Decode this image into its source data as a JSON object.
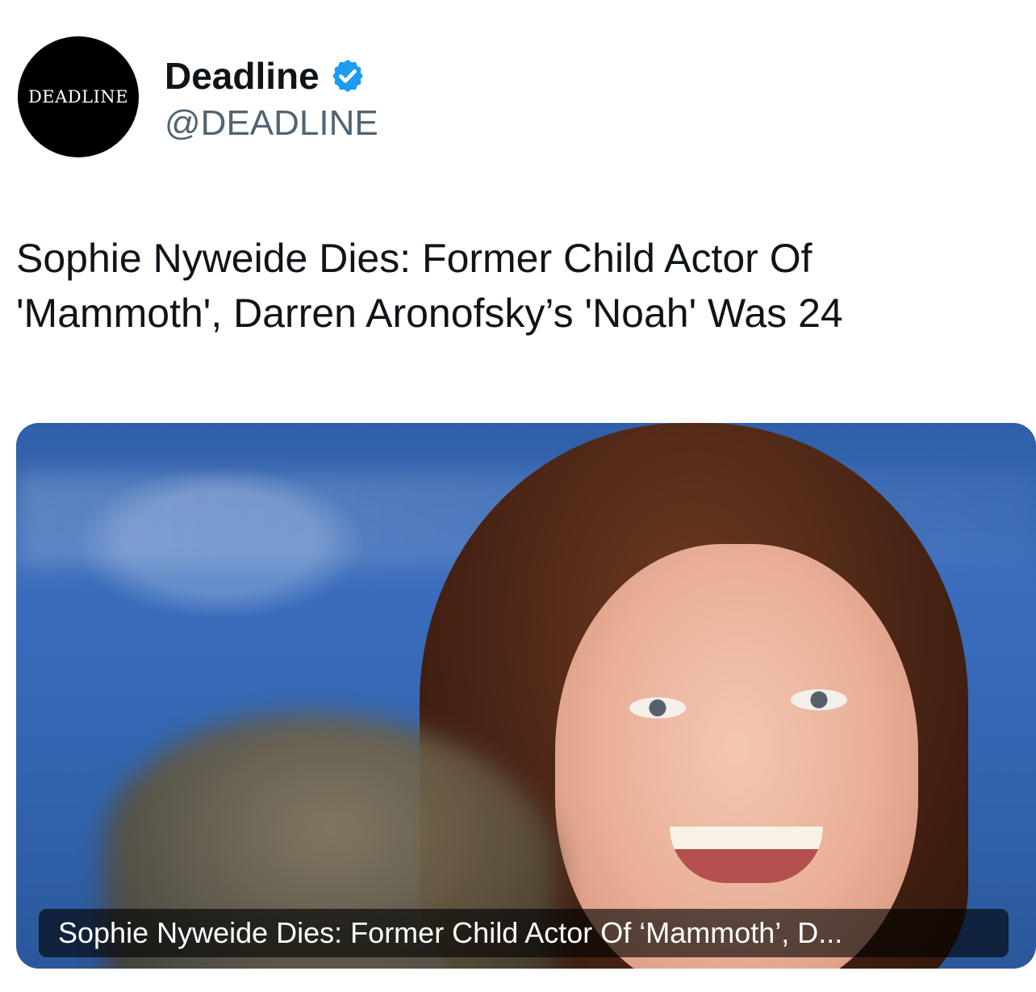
{
  "account": {
    "avatar_text": "DEADLINE",
    "display_name": "Deadline",
    "handle": "@DEADLINE",
    "verified_icon": "verified-badge-icon",
    "verified_color": "#1d9bf0"
  },
  "tweet": {
    "text_line1": "Sophie Nyweide Dies: Former Child Actor Of",
    "text_line2": "'Mammoth', Darren Aronofsky’s 'Noah' Was 24"
  },
  "link_card": {
    "image_description_icon": "photo-icon",
    "caption": "Sophie Nyweide Dies: Former Child Actor Of ‘Mammoth’, D..."
  },
  "colors": {
    "text_primary": "#0f1419",
    "text_secondary": "#536471",
    "avatar_bg": "#000000"
  }
}
